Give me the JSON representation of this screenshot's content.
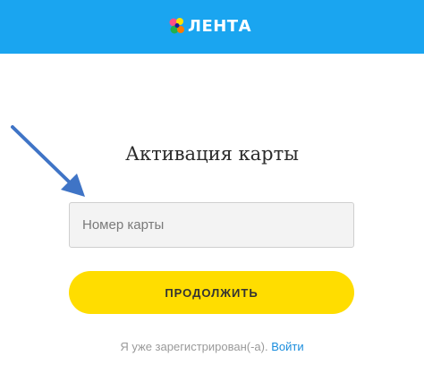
{
  "header": {
    "brand": "ЛЕНТА",
    "background": "#1aa5f0"
  },
  "main": {
    "title": "Активация карты",
    "card_input": {
      "placeholder": "Номер карты",
      "value": ""
    },
    "continue_label": "ПРОДОЛЖИТЬ",
    "accent": "#ffdd00"
  },
  "footer": {
    "registered_text": "Я уже зарегистрирован(-а).",
    "login_link": "Войти"
  },
  "annotation": {
    "icon": "arrow-icon",
    "color": "#3f74c6"
  }
}
